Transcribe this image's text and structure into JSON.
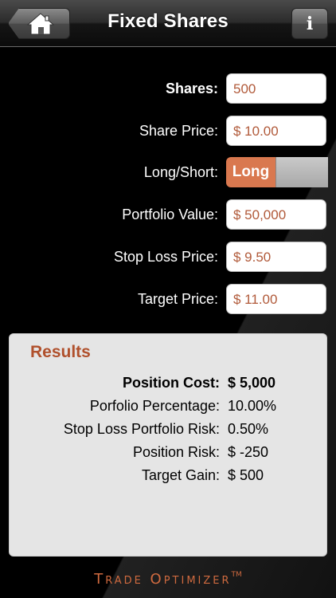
{
  "header": {
    "title": "Fixed Shares"
  },
  "form": {
    "shares": {
      "label": "Shares:",
      "value": "500"
    },
    "share_price": {
      "label": "Share Price:",
      "value": "$ 10.00"
    },
    "long_short": {
      "label": "Long/Short:",
      "value": "Long"
    },
    "portfolio_value": {
      "label": "Portfolio Value:",
      "value": "$ 50,000"
    },
    "stop_loss_price": {
      "label": "Stop Loss Price:",
      "value": "$ 9.50"
    },
    "target_price": {
      "label": "Target Price:",
      "value": "$ 11.00"
    }
  },
  "results": {
    "title": "Results",
    "rows": [
      {
        "label": "Position Cost:",
        "value": "$ 5,000"
      },
      {
        "label": "Porfolio Percentage:",
        "value": "10.00%"
      },
      {
        "label": "Stop Loss Portfolio Risk:",
        "value": "0.50%"
      },
      {
        "label": "Position Risk:",
        "value": "$ -250"
      },
      {
        "label": "Target Gain:",
        "value": "$ 500"
      }
    ]
  },
  "brand": {
    "name": "Trade Optimizer",
    "tm": "TM"
  },
  "colors": {
    "accent": "#d9784f",
    "field_text": "#b15a3a",
    "results_title": "#b0502c"
  },
  "icons": {
    "home": "home-icon",
    "info": "info-icon"
  }
}
